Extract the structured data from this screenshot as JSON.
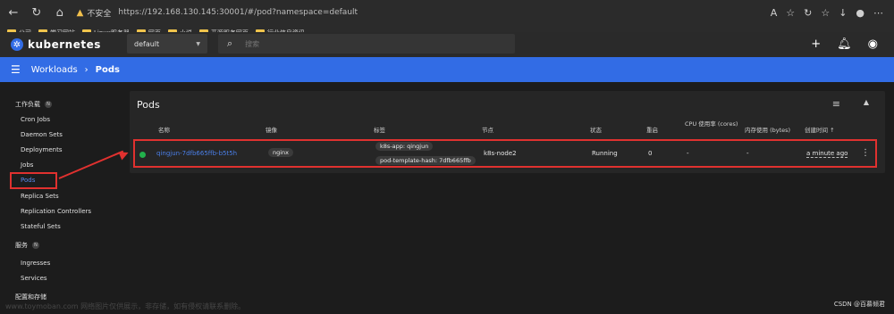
{
  "browser": {
    "insecure_label": "不安全",
    "url": "https://192.168.130.145:30001/#/pod?namespace=default",
    "bookmarks": [
      "公司",
      "学习网站",
      "Linux服务器",
      "网页",
      "小说",
      "开源服务网页",
      "行业信息资讯"
    ]
  },
  "header": {
    "brand": "kubernetes",
    "namespace": "default",
    "search_placeholder": "搜索"
  },
  "breadcrumb": {
    "parent": "Workloads",
    "current": "Pods"
  },
  "sidebar": {
    "sections": [
      {
        "title": "工作负载",
        "badge": "N",
        "items": [
          "Cron Jobs",
          "Daemon Sets",
          "Deployments",
          "Jobs",
          "Pods",
          "Replica Sets",
          "Replication Controllers",
          "Stateful Sets"
        ]
      },
      {
        "title": "服务",
        "badge": "N",
        "items": [
          "Ingresses",
          "Services"
        ]
      },
      {
        "title": "配置和存储",
        "badge": "",
        "items": []
      }
    ],
    "active_item": "Pods"
  },
  "card": {
    "title": "Pods",
    "columns": {
      "name": "名称",
      "image": "镜像",
      "labels": "标签",
      "node": "节点",
      "status": "状态",
      "restarts": "重启",
      "cpu": "CPU 使用率 (cores)",
      "memory": "内存使用 (bytes)",
      "created": "创建时间 ↑"
    },
    "rows": [
      {
        "name": "qingjun-7dfb665ffb-b5t5h",
        "image": "nginx",
        "labels": [
          "k8s-app: qingjun",
          "pod-template-hash: 7dfb665ffb"
        ],
        "node": "k8s-node2",
        "status": "Running",
        "restarts": "0",
        "cpu": "-",
        "memory": "-",
        "created": "a minute ago",
        "status_color": "#22b14c"
      }
    ]
  },
  "colors": {
    "accent": "#326ce5",
    "highlight": "#e0312f",
    "running": "#22b14c"
  },
  "watermark": {
    "left": "www.toymoban.com 网络图片仅供展示，非存储，如有侵权请联系删除。",
    "right": "CSDN @百慕倾君"
  }
}
